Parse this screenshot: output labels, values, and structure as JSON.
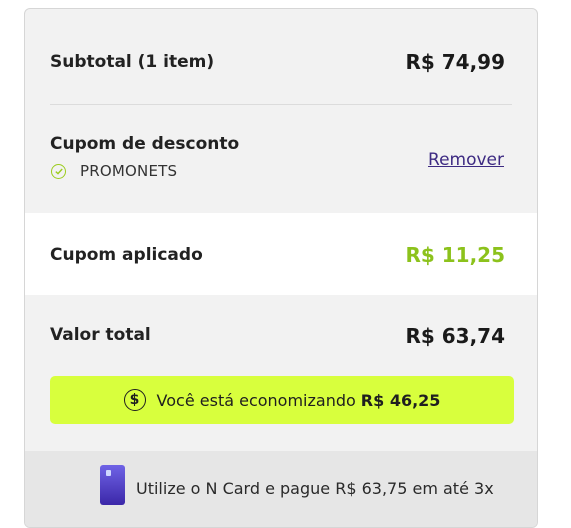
{
  "summary": {
    "subtotal_label": "Subtotal (1 item)",
    "subtotal_value": "R$ 74,99",
    "coupon_label": "Cupom de desconto",
    "coupon_code": "PROMONETS",
    "remove_label": "Remover",
    "applied_label": "Cupom aplicado",
    "applied_value": "R$ 11,25",
    "total_label": "Valor total",
    "total_value": "R$ 63,74"
  },
  "savings": {
    "text": "Você está economizando",
    "amount": "R$ 46,25",
    "icon": "dollar-circle-icon"
  },
  "ncard": {
    "text": "Utilize o N Card e pague R$ 63,75 em até 3x",
    "icon": "n-card-image"
  },
  "colors": {
    "accent_green": "#8cc21c",
    "savings_bg": "#d8ff3d",
    "link_purple": "#3d2a82"
  }
}
